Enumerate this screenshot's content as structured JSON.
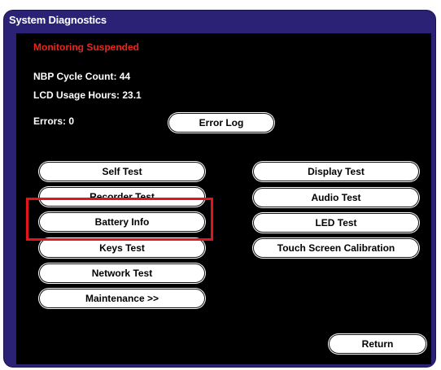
{
  "window": {
    "title": "System Diagnostics"
  },
  "status": {
    "text": "Monitoring Suspended",
    "color": "#e8271f"
  },
  "info": {
    "nbp_cycle_count": "NBP Cycle Count: 44",
    "lcd_usage_hours": "LCD Usage Hours: 23.1",
    "errors": "Errors: 0"
  },
  "buttons": {
    "error_log": "Error Log",
    "self_test": "Self Test",
    "recorder_test": "Recorder Test",
    "battery_info": "Battery Info",
    "keys_test": "Keys Test",
    "network_test": "Network Test",
    "maintenance": "Maintenance >>",
    "display_test": "Display Test",
    "audio_test": "Audio Test",
    "led_test": "LED Test",
    "touch_screen_calibration": "Touch Screen Calibration",
    "return": "Return"
  },
  "colors": {
    "frame": "#2b2276",
    "panel": "#000000",
    "highlight": "#e3141b"
  }
}
